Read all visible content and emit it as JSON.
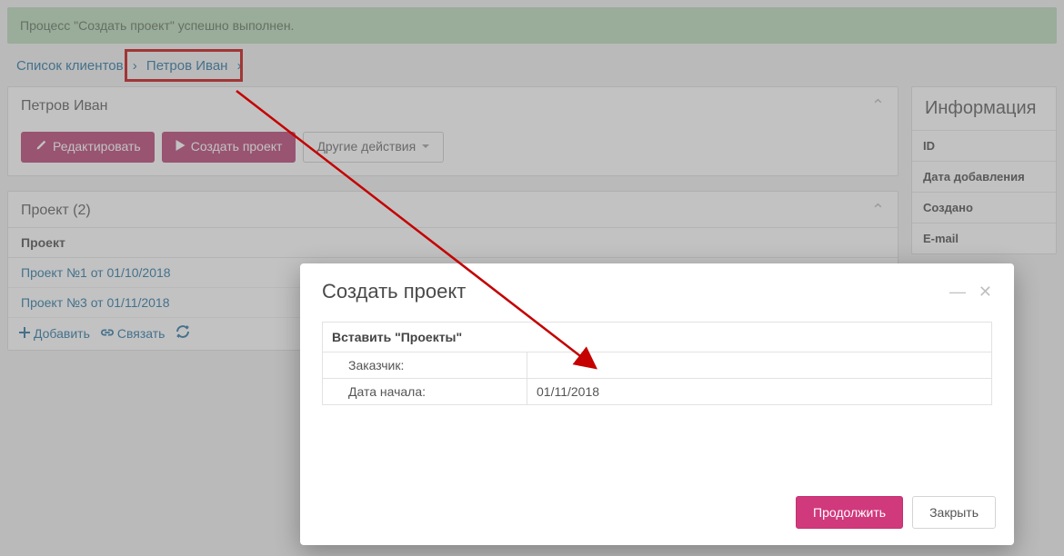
{
  "alert": {
    "success_text": "Процесс \"Создать проект\" успешно выполнен."
  },
  "breadcrumb": {
    "item1": "Список клиентов",
    "item2": "Петров Иван"
  },
  "client_panel": {
    "title": "Петров Иван",
    "edit_btn": "Редактировать",
    "create_project_btn": "Создать проект",
    "other_actions_btn": "Другие действия"
  },
  "projects_panel": {
    "title": "Проект (2)",
    "col_header": "Проект",
    "items": [
      "Проект №1 от 01/10/2018",
      "Проект №3 от 01/11/2018"
    ],
    "add_btn": "Добавить",
    "link_btn": "Связать"
  },
  "info_panel": {
    "title": "Информация",
    "rows": [
      "ID",
      "Дата добавления",
      "Создано",
      "E-mail"
    ]
  },
  "modal": {
    "title": "Создать проект",
    "section_title": "Вставить \"Проекты\"",
    "fields": {
      "customer_label": "Заказчик:",
      "customer_value": "",
      "start_date_label": "Дата начала:",
      "start_date_value": "01/11/2018"
    },
    "continue_btn": "Продолжить",
    "close_btn": "Закрыть"
  }
}
